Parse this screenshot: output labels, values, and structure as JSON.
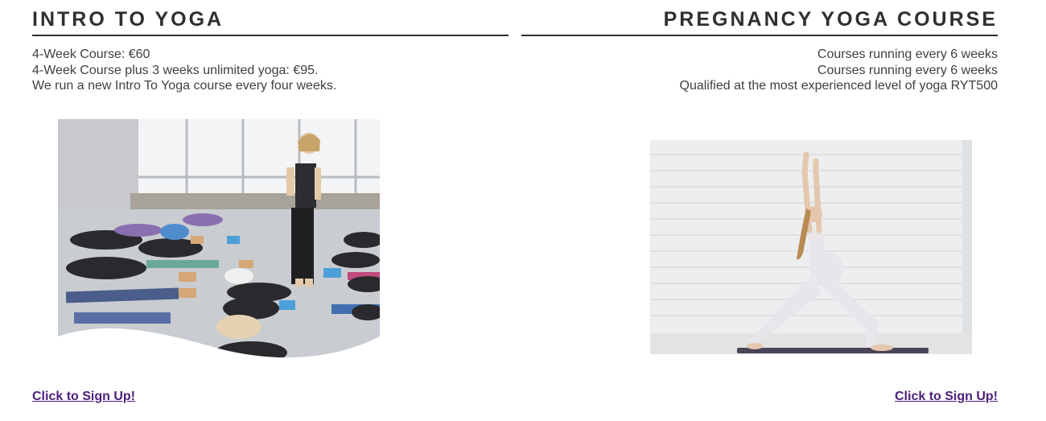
{
  "intro": {
    "title": "INTRO TO YOGA",
    "lines": [
      "4-Week Course: €60",
      "4-Week Course plus 3 weeks unlimited yoga: €95.",
      "We run a new Intro To Yoga course every four weeks."
    ],
    "image_alt": "Yoga class with students resting on mats while instructor speaks",
    "signup_label": "Click to Sign Up!"
  },
  "pregnancy": {
    "title": "PREGNANCY YOGA COURSE",
    "lines": [
      "Courses running every 6 weeks",
      "Courses running every 6 weeks",
      "Qualified at the most experienced level of yoga RYT500"
    ],
    "image_alt": "Pregnant woman in warrior yoga pose against white brick wall",
    "signup_label": "Click to Sign Up!"
  },
  "colors": {
    "heading": "#2f2f2f",
    "body_text": "#3f3f3f",
    "link": "#4b1f7a",
    "background": "#ffffff"
  }
}
